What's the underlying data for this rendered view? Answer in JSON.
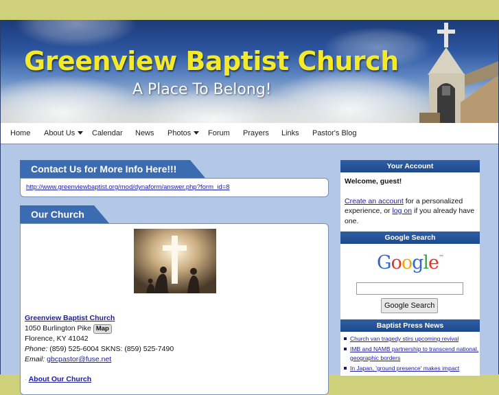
{
  "banner": {
    "title": "Greenview Baptist Church",
    "subtitle": "A Place To Belong!"
  },
  "nav": {
    "items": [
      {
        "label": "Home",
        "has_menu": false
      },
      {
        "label": "About Us",
        "has_menu": true
      },
      {
        "label": "Calendar",
        "has_menu": false
      },
      {
        "label": "News",
        "has_menu": false
      },
      {
        "label": "Photos",
        "has_menu": true
      },
      {
        "label": "Forum",
        "has_menu": false
      },
      {
        "label": "Prayers",
        "has_menu": false
      },
      {
        "label": "Links",
        "has_menu": false
      },
      {
        "label": "Pastor's Blog",
        "has_menu": false
      }
    ]
  },
  "contact": {
    "heading": "Contact Us for More Info Here!!!",
    "link": "http://www.greenviewbaptist.org/mod/dynaform/answer.php?form_id=8"
  },
  "our_church": {
    "heading": "Our Church",
    "name": "Greenview Baptist Church",
    "address1": "1050 Burlington Pike",
    "map_button": "Map",
    "address2": "Florence, KY 41042",
    "phone_label": "Phone:",
    "phone_value": "(859) 525-6004 SKNS: (859) 525-7490",
    "email_label": "Email:",
    "email_value": "gbcpastor@fuse.net",
    "about_link": "About Our Church"
  },
  "account": {
    "heading": "Your Account",
    "welcome": "Welcome, guest!",
    "create_link": "Create an account",
    "text_1": " for a personalized experience, or ",
    "logon_link": "log on",
    "text_2": " if you already have one."
  },
  "search": {
    "heading": "Google Search",
    "logo": "Google",
    "button": "Google Search",
    "input_value": ""
  },
  "news": {
    "heading": "Baptist Press News",
    "items": [
      "Church van tragedy stirs upcoming revival",
      "IMB and NAMB partnership to transcend national, geographic borders",
      "In Japan, 'ground presence' makes impact"
    ]
  },
  "colors": {
    "accent_blue": "#3b6cb1",
    "title_yellow": "#f2ea2a",
    "content_bg": "#b3c8e6",
    "top_bar": "#cfd07a"
  }
}
